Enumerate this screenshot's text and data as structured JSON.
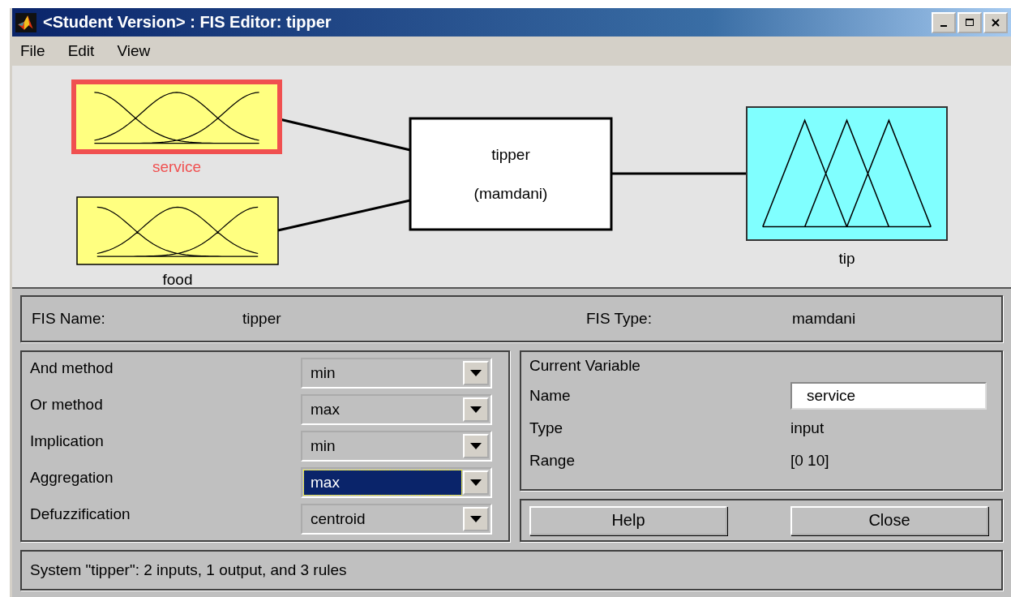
{
  "window": {
    "title": "<Student Version> : FIS Editor: tipper"
  },
  "menu": [
    "File",
    "Edit",
    "View"
  ],
  "diagram": {
    "inputs": [
      {
        "name": "service",
        "selected": true
      },
      {
        "name": "food",
        "selected": false
      }
    ],
    "system": {
      "name": "tipper",
      "type": "(mamdani)"
    },
    "outputs": [
      {
        "name": "tip",
        "selected": false
      }
    ]
  },
  "fis_info": {
    "name_label": "FIS Name:",
    "name": "tipper",
    "type_label": "FIS Type:",
    "type": "mamdani"
  },
  "methods": [
    {
      "label": "And method",
      "value": "min",
      "selected": false
    },
    {
      "label": "Or method",
      "value": "max",
      "selected": false
    },
    {
      "label": "Implication",
      "value": "min",
      "selected": false
    },
    {
      "label": "Aggregation",
      "value": "max",
      "selected": true
    },
    {
      "label": "Defuzzification",
      "value": "centroid",
      "selected": false
    }
  ],
  "current_variable": {
    "title": "Current Variable",
    "name_label": "Name",
    "name": "service",
    "type_label": "Type",
    "type": "input",
    "range_label": "Range",
    "range": "[0 10]"
  },
  "buttons": [
    "Help",
    "Close"
  ],
  "status_bar": "System \"tipper\": 2 inputs, 1 output, and 3 rules"
}
